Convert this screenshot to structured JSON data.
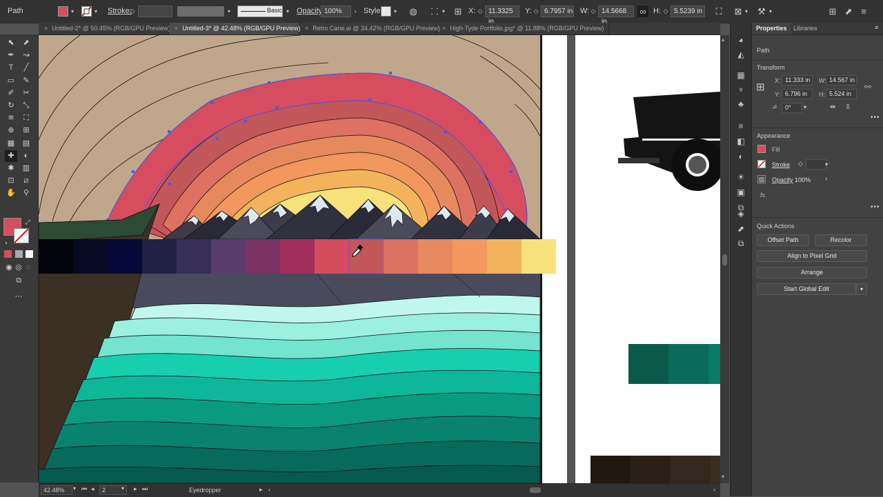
{
  "control_bar": {
    "object_type": "Path",
    "fill_color": "#d64d5f",
    "stroke_label": "Stroke:",
    "stroke_weight": "",
    "brush_label": "Basic",
    "opacity_label": "Opacity:",
    "opacity_value": "100%",
    "style_label": "Style:",
    "x_label": "X:",
    "x_value": "11.3325 in",
    "y_label": "Y:",
    "y_value": "6.7957 in",
    "w_label": "W:",
    "w_value": "14.5668 in",
    "h_label": "H:",
    "h_value": "5.5239 in"
  },
  "tabs": [
    {
      "label": "Untitled-2* @ 50.45% (RGB/GPU Preview)",
      "active": false
    },
    {
      "label": "Untitled-3* @ 42.48% (RGB/GPU Preview)",
      "active": true
    },
    {
      "label": "Retro Carai.ai @ 34.42% (RGB/GPU Preview)",
      "active": false
    },
    {
      "label": "High-Tyde Portfolio.jpg* @ 11.88% (RGB/GPU Preview)",
      "active": false
    }
  ],
  "tools": [
    "selection",
    "direct-selection",
    "pen",
    "curvature",
    "type",
    "line",
    "rectangle",
    "paintbrush",
    "shaper",
    "scissors",
    "rotate",
    "scale",
    "width",
    "free-transform",
    "shape-builder",
    "perspective",
    "mesh",
    "gradient",
    "eyedropper",
    "blend",
    "symbol-sprayer",
    "column-graph",
    "artboard",
    "slice",
    "hand",
    "zoom"
  ],
  "tool_icons": [
    "⬉",
    "⬈",
    "✒",
    "↝",
    "T",
    "╱",
    "▭",
    "✎",
    "✐",
    "✂",
    "↻",
    "⤡",
    "≋",
    "⛶",
    "⊕",
    "⊞",
    "▦",
    "▤",
    "✚",
    "◐",
    "✱",
    "▥",
    "⊡",
    "⧄",
    "✋",
    "⚲"
  ],
  "swatches": {
    "fill_color": "#d64d5f",
    "palette": [
      "#04040c",
      "#070a22",
      "#06083a",
      "#1f2244",
      "#372f58",
      "#5a3b6e",
      "#7a3164",
      "#a22e5c",
      "#d44d5f",
      "#c25759",
      "#dd7162",
      "#e68a5d",
      "#f2975d",
      "#f3b35d",
      "#f7e27c"
    ],
    "hover_index": 9
  },
  "status_bar": {
    "zoom": "42.48%",
    "artboard_number": "2",
    "current_tool": "Eyedropper"
  },
  "properties_panel": {
    "tab_properties": "Properties",
    "tab_libraries": "Libraries",
    "selection_type": "Path",
    "transform_title": "Transform",
    "x_label": "X:",
    "x_value": "11.333 in",
    "y_label": "Y:",
    "y_value": "6.796 in",
    "w_label": "W:",
    "w_value": "14.567 in",
    "h_label": "H:",
    "h_value": "5.524 in",
    "angle_value": "0°",
    "appearance_title": "Appearance",
    "fill_label": "Fill",
    "stroke_label": "Stroke",
    "opacity_label": "Opacity",
    "opacity_value": "100%",
    "fx_label": "fx.",
    "quick_actions_title": "Quick Actions",
    "offset_path_button": "Offset Path",
    "recolor_button": "Recolor",
    "align_pixel_button": "Align to Pixel Grid",
    "arrange_button": "Arrange",
    "global_edit_button": "Start Global Edit"
  }
}
